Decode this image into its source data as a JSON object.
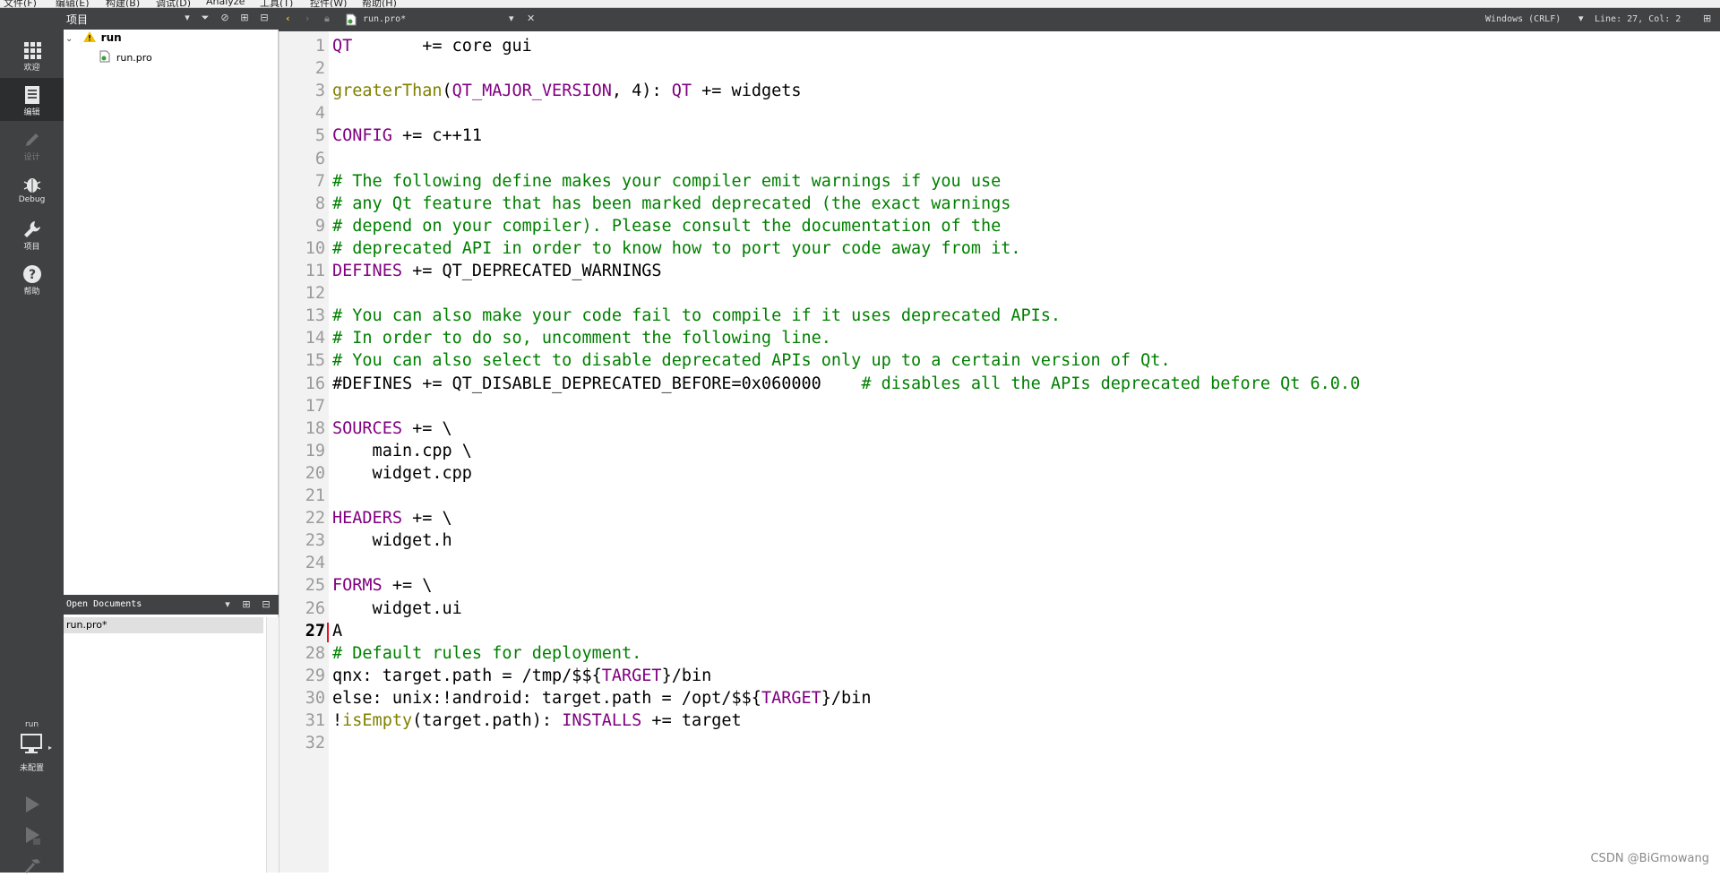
{
  "menubar": {
    "items": [
      "文件(F)",
      "编辑(E)",
      "构建(B)",
      "调试(D)",
      "Analyze",
      "工具(T)",
      "控件(W)",
      "帮助(H)"
    ]
  },
  "modes": [
    {
      "label": "欢迎",
      "icon": "grid-icon",
      "active": false
    },
    {
      "label": "编辑",
      "icon": "document-icon",
      "active": true
    },
    {
      "label": "设计",
      "icon": "pencil-icon",
      "active": false,
      "disabled": true
    },
    {
      "label": "Debug",
      "icon": "bug-icon",
      "active": false
    },
    {
      "label": "项目",
      "icon": "wrench-icon",
      "active": false
    },
    {
      "label": "帮助",
      "icon": "help-icon",
      "active": false
    }
  ],
  "kit": {
    "project": "run",
    "label": "未配置"
  },
  "project_pane": {
    "title": "项目",
    "tree": {
      "project": "run",
      "file": "run.pro"
    }
  },
  "open_docs": {
    "title": "Open Documents",
    "items": [
      "run.pro*"
    ]
  },
  "editor": {
    "file_tab": "run.pro*",
    "encoding": "Windows (CRLF)",
    "position": "Line: 27, Col: 2",
    "current_line": 27,
    "lines": [
      "QT       += core gui",
      "",
      "greaterThan(QT_MAJOR_VERSION, 4): QT += widgets",
      "",
      "CONFIG += c++11",
      "",
      "# The following define makes your compiler emit warnings if you use",
      "# any Qt feature that has been marked deprecated (the exact warnings",
      "# depend on your compiler). Please consult the documentation of the",
      "# deprecated API in order to know how to port your code away from it.",
      "DEFINES += QT_DEPRECATED_WARNINGS",
      "",
      "# You can also make your code fail to compile if it uses deprecated APIs.",
      "# In order to do so, uncomment the following line.",
      "# You can also select to disable deprecated APIs only up to a certain version of Qt.",
      "#DEFINES += QT_DISABLE_DEPRECATED_BEFORE=0x060000    # disables all the APIs deprecated before Qt 6.0.0",
      "",
      "SOURCES += \\",
      "    main.cpp \\",
      "    widget.cpp",
      "",
      "HEADERS += \\",
      "    widget.h",
      "",
      "FORMS += \\",
      "    widget.ui",
      "A",
      "# Default rules for deployment.",
      "qnx: target.path = /tmp/$${TARGET}/bin",
      "else: unix:!android: target.path = /opt/$${TARGET}/bin",
      "!isEmpty(target.path): INSTALLS += target",
      ""
    ]
  },
  "watermark": "CSDN @BiGmowang",
  "colors": {
    "keyword": "#800080",
    "function": "#808000",
    "comment": "#008000",
    "sidebar": "#3f4142",
    "header": "#404244"
  }
}
